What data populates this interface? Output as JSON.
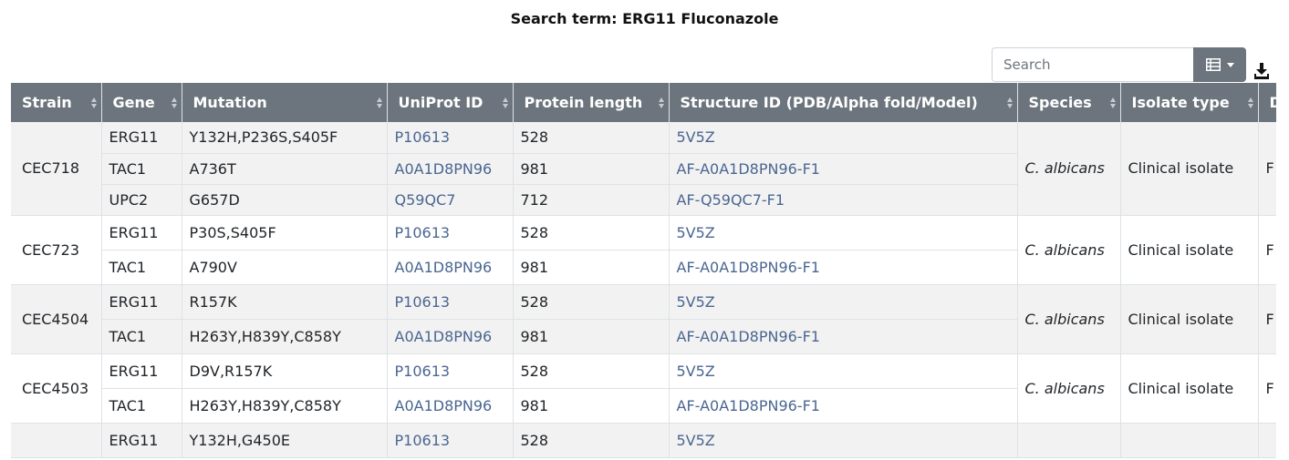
{
  "title": "Search term: ERG11 Fluconazole",
  "search": {
    "placeholder": "Search"
  },
  "icons": {
    "columns": "columns-icon",
    "dropdown": "caret-down-icon",
    "download": "download-icon"
  },
  "colors": {
    "header_bg": "#6c757d",
    "link": "#4a6691",
    "row_striped": "#f2f2f2"
  },
  "columns": [
    "Strain",
    "Gene",
    "Mutation",
    "UniProt ID",
    "Protein length",
    "Structure ID (PDB/Alpha fold/Model)",
    "Species",
    "Isolate type",
    "D"
  ],
  "groups": [
    {
      "strain": "CEC718",
      "species": "C. albicans",
      "isolate_type": "Clinical isolate",
      "extra": "F",
      "rows": [
        {
          "gene": "ERG11",
          "mutation": "Y132H,P236S,S405F",
          "uniprot": "P10613",
          "length": "528",
          "structure": "5V5Z"
        },
        {
          "gene": "TAC1",
          "mutation": "A736T",
          "uniprot": "A0A1D8PN96",
          "length": "981",
          "structure": "AF-A0A1D8PN96-F1"
        },
        {
          "gene": "UPC2",
          "mutation": "G657D",
          "uniprot": "Q59QC7",
          "length": "712",
          "structure": "AF-Q59QC7-F1"
        }
      ]
    },
    {
      "strain": "CEC723",
      "species": "C. albicans",
      "isolate_type": "Clinical isolate",
      "extra": "F",
      "rows": [
        {
          "gene": "ERG11",
          "mutation": "P30S,S405F",
          "uniprot": "P10613",
          "length": "528",
          "structure": "5V5Z"
        },
        {
          "gene": "TAC1",
          "mutation": "A790V",
          "uniprot": "A0A1D8PN96",
          "length": "981",
          "structure": "AF-A0A1D8PN96-F1"
        }
      ]
    },
    {
      "strain": "CEC4504",
      "species": "C. albicans",
      "isolate_type": "Clinical isolate",
      "extra": "F",
      "rows": [
        {
          "gene": "ERG11",
          "mutation": "R157K",
          "uniprot": "P10613",
          "length": "528",
          "structure": "5V5Z"
        },
        {
          "gene": "TAC1",
          "mutation": "H263Y,H839Y,C858Y",
          "uniprot": "A0A1D8PN96",
          "length": "981",
          "structure": "AF-A0A1D8PN96-F1"
        }
      ]
    },
    {
      "strain": "CEC4503",
      "species": "C. albicans",
      "isolate_type": "Clinical isolate",
      "extra": "F",
      "rows": [
        {
          "gene": "ERG11",
          "mutation": "D9V,R157K",
          "uniprot": "P10613",
          "length": "528",
          "structure": "5V5Z"
        },
        {
          "gene": "TAC1",
          "mutation": "H263Y,H839Y,C858Y",
          "uniprot": "A0A1D8PN96",
          "length": "981",
          "structure": "AF-A0A1D8PN96-F1"
        }
      ]
    },
    {
      "strain": "",
      "species": "",
      "isolate_type": "",
      "extra": "",
      "rows": [
        {
          "gene": "ERG11",
          "mutation": "Y132H,G450E",
          "uniprot": "P10613",
          "length": "528",
          "structure": "5V5Z"
        }
      ]
    }
  ]
}
